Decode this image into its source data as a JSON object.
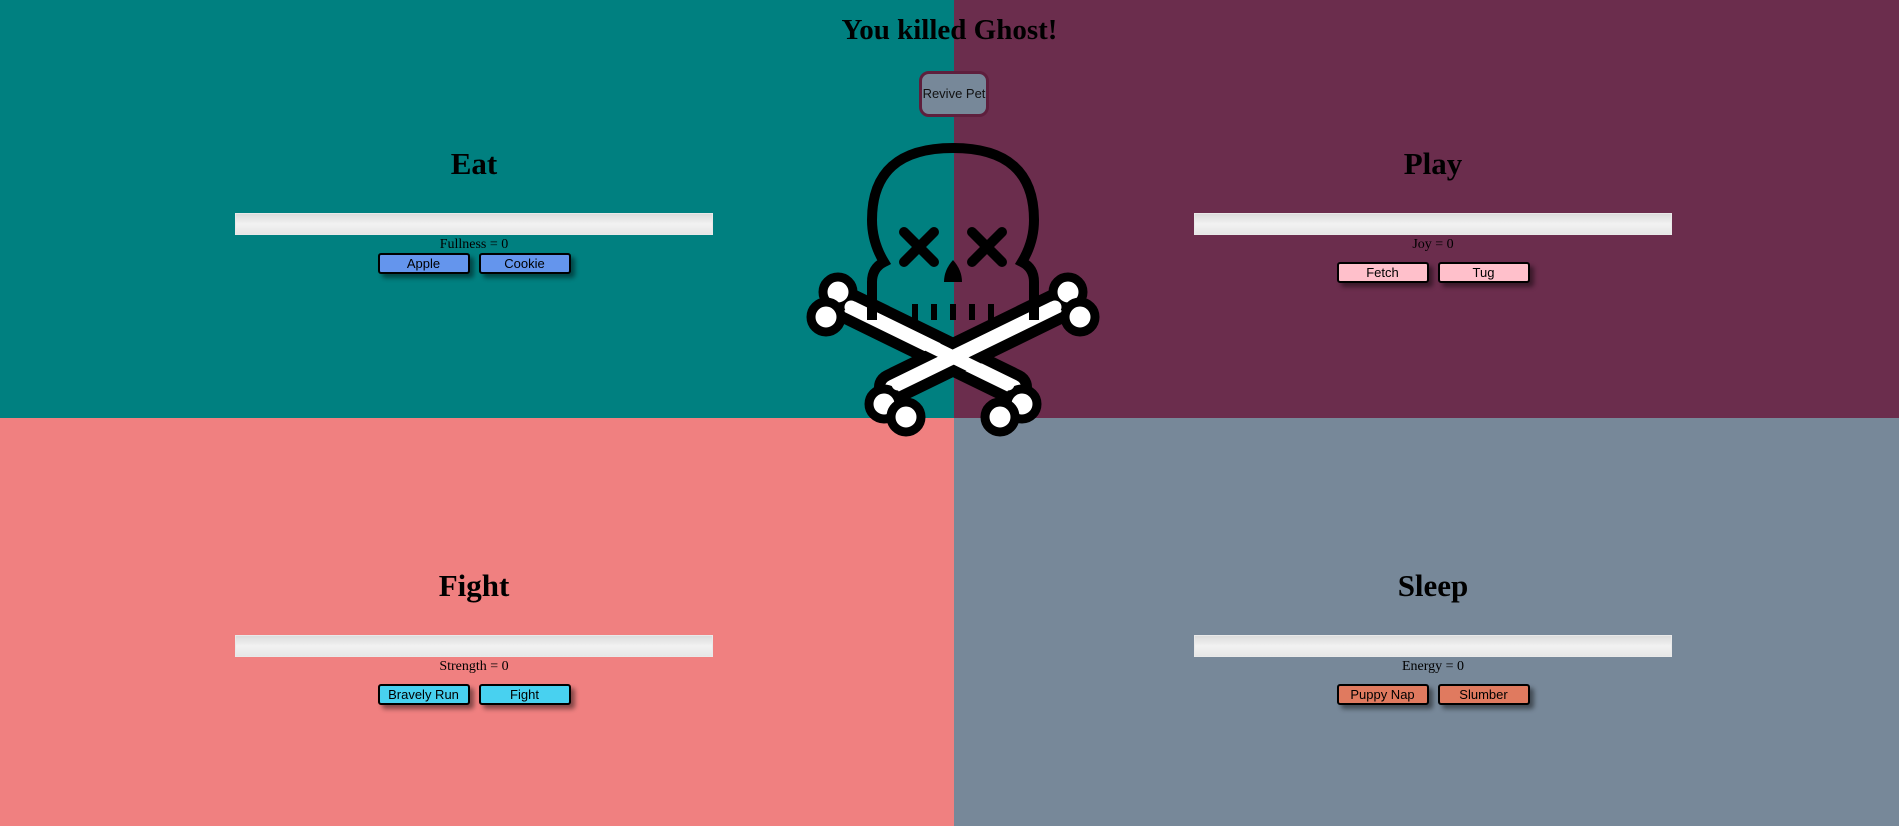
{
  "title": "You killed Ghost!",
  "revive": {
    "label": "Revive Pet"
  },
  "eat": {
    "heading": "Eat",
    "stat": "Fullness = 0",
    "value": 0,
    "buttons": [
      "Apple",
      "Cookie"
    ],
    "button_color": "#6495ed",
    "bg": "#008080"
  },
  "play": {
    "heading": "Play",
    "stat": "Joy = 0",
    "value": 0,
    "buttons": [
      "Fetch",
      "Tug"
    ],
    "button_color": "#ffc0cb",
    "bg": "#6b2d4d"
  },
  "fight": {
    "heading": "Fight",
    "stat": "Strength = 0",
    "value": 0,
    "buttons": [
      "Bravely Run",
      "Fight"
    ],
    "button_color": "#48d1f0",
    "bg": "#f08080"
  },
  "sleep": {
    "heading": "Sleep",
    "stat": "Energy = 0",
    "value": 0,
    "buttons": [
      "Puppy Nap",
      "Slumber"
    ],
    "button_color": "#e07a5f",
    "bg": "#778899"
  },
  "icons": {
    "dead_pet": "skull-crossbones-icon"
  }
}
